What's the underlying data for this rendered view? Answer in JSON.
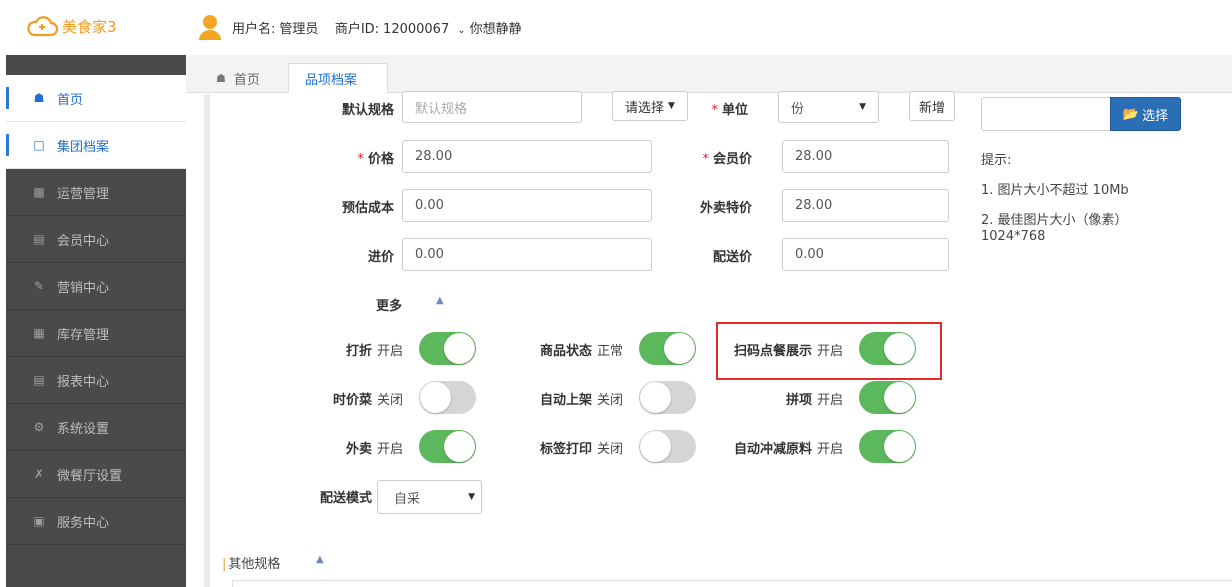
{
  "header": {
    "app_name": "美食家3",
    "user_label": "用户名:",
    "user_name": "管理员",
    "merchant_label": "商户ID:",
    "merchant_id": "12000067",
    "user_nick": "你想静静"
  },
  "sidebar": {
    "items": [
      {
        "label": "首页",
        "icon": "home-icon",
        "active": true
      },
      {
        "label": "集团档案",
        "icon": "file-icon",
        "active": true
      },
      {
        "label": "运营管理",
        "icon": "bar-chart-icon",
        "active": false
      },
      {
        "label": "会员中心",
        "icon": "id-card-icon",
        "active": false
      },
      {
        "label": "营销中心",
        "icon": "edit-icon",
        "active": false
      },
      {
        "label": "库存管理",
        "icon": "building-icon",
        "active": false
      },
      {
        "label": "报表中心",
        "icon": "document-icon",
        "active": false
      },
      {
        "label": "系统设置",
        "icon": "gears-icon",
        "active": false
      },
      {
        "label": "微餐厅设置",
        "icon": "cutlery-icon",
        "active": false
      },
      {
        "label": "服务中心",
        "icon": "square-icon",
        "active": false
      }
    ]
  },
  "tabs": {
    "home": "首页",
    "current": "品项档案"
  },
  "form": {
    "default_spec_label": "默认规格",
    "default_spec_placeholder": "默认规格",
    "select_btn": "请选择",
    "unit_label": "单位",
    "unit_value": "份",
    "add_btn": "新增",
    "price_label": "价格",
    "price_value": "28.00",
    "member_price_label": "会员价",
    "member_price_value": "28.00",
    "est_cost_label": "预估成本",
    "est_cost_value": "0.00",
    "takeout_price_label": "外卖特价",
    "takeout_price_value": "28.00",
    "purchase_label": "进价",
    "purchase_value": "0.00",
    "delivery_price_label": "配送价",
    "delivery_price_value": "0.00",
    "more_label": "更多",
    "delivery_mode_label": "配送模式",
    "delivery_mode_value": "自采",
    "other_spec_label": "其他规格"
  },
  "image_upload": {
    "choose_btn": "选择",
    "hint_title": "提示:",
    "hint_1": "1. 图片大小不超过 10Mb",
    "hint_2": "2. 最佳图片大小（像素）",
    "hint_2b": "1024*768"
  },
  "switches": {
    "discount": {
      "label": "打折",
      "state": "开启",
      "on": true
    },
    "status": {
      "label": "商品状态",
      "state": "正常",
      "on": true
    },
    "scan_show": {
      "label": "扫码点餐展示",
      "state": "开启",
      "on": true
    },
    "seasonal": {
      "label": "时价菜",
      "state": "关闭",
      "on": false
    },
    "auto_shelf": {
      "label": "自动上架",
      "state": "关闭",
      "on": false
    },
    "combo": {
      "label": "拼项",
      "state": "开启",
      "on": true
    },
    "takeout": {
      "label": "外卖",
      "state": "开启",
      "on": true
    },
    "label_print": {
      "label": "标签打印",
      "state": "关闭",
      "on": false
    },
    "auto_deduct": {
      "label": "自动冲减原料",
      "state": "开启",
      "on": true
    }
  },
  "colors": {
    "accent": "#2a7ad8",
    "toggle_on": "#5cb85c",
    "highlight": "#e12b2b"
  }
}
